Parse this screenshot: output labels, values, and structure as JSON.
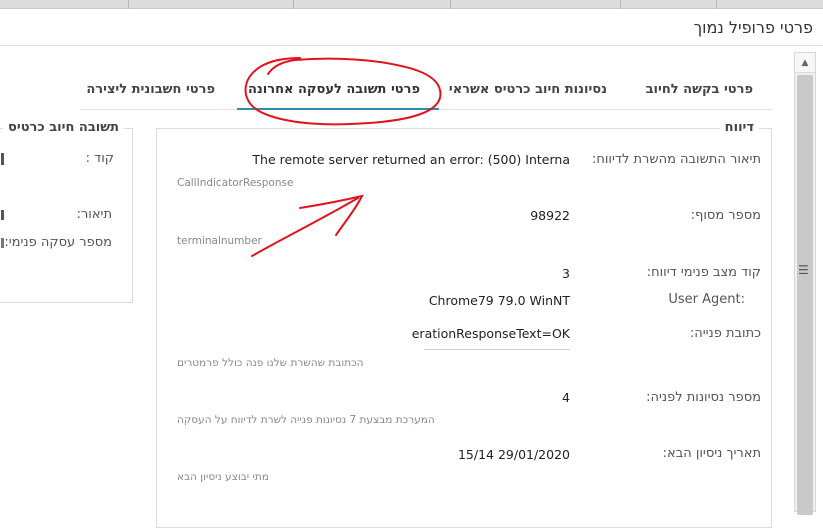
{
  "window": {
    "title": "פרטי פרופיל נמוך"
  },
  "tabs": [
    {
      "label": "פרטי בקשה לחיוב"
    },
    {
      "label": "נסיונות חיוב כרטיס אשראי"
    },
    {
      "label": "פרטי תשובה לעסקה אחרונה"
    },
    {
      "label": "פרטי חשבונית ליצירה"
    }
  ],
  "report": {
    "legend": "דיווח",
    "fields": {
      "response_desc": {
        "label": "תיאור התשובה מהשרת לדיווח:",
        "value": "The remote server returned an error: (500) Interna",
        "hint": "CallIndicatorResponse"
      },
      "terminal": {
        "label": "מספר מסוף:",
        "value": "98922",
        "hint": "terminalnumber"
      },
      "status_code": {
        "label": "קוד מצב פנימי דיווח:",
        "value": "3"
      },
      "user_agent": {
        "label": "User Agent:",
        "value": "Chrome79 79.0 WinNT"
      },
      "address": {
        "label": "כתובת פנייה:",
        "value": "erationResponseText=OK",
        "hint": "הכתובת שהשרת שלנו פנה כולל פרמטרים"
      },
      "attempts": {
        "label": "מספר נסיונות לפניה:",
        "value": "4",
        "hint": "המערכת מבצעת 7 נסיונות פנייה לשרת לדיווח על העסקה"
      },
      "next_try": {
        "label": "תאריך ניסיון הבא:",
        "value": "15/14 29/01/2020",
        "hint": "מתי יבוצע ניסיון הבא"
      }
    }
  },
  "card": {
    "legend": "תשובה חיוב כרטיס",
    "fields": {
      "code": {
        "label": "קוד :"
      },
      "desc": {
        "label": "תיאור:"
      },
      "internal_tx": {
        "label": "מספר עסקה פנימי:"
      }
    }
  },
  "colors": {
    "accent": "#2f89b2",
    "annotation": "#e0141e"
  }
}
